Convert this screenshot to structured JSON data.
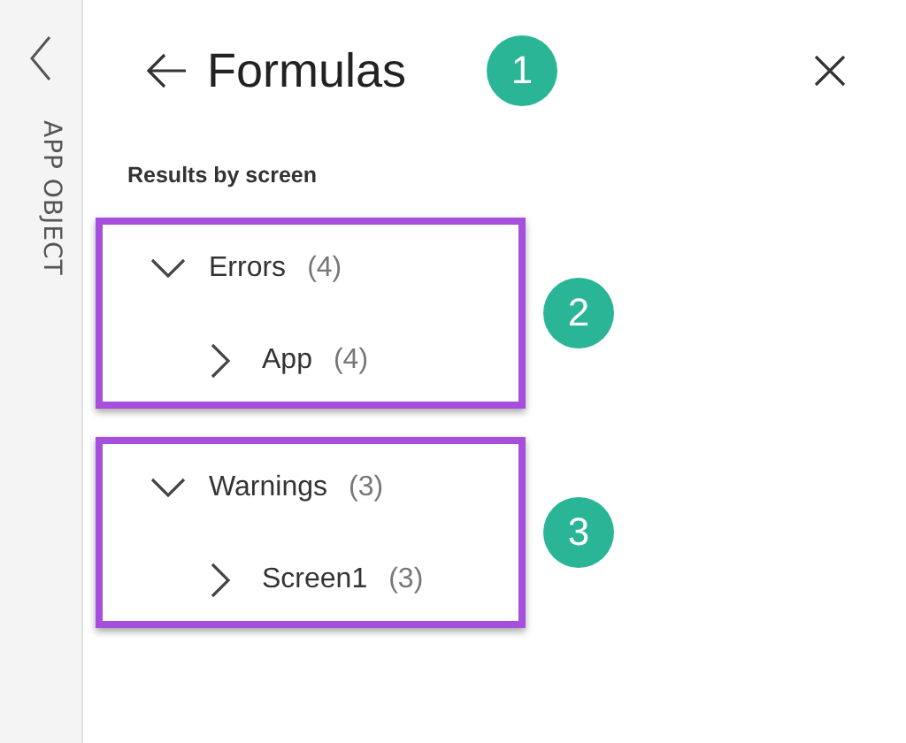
{
  "side_rail": {
    "label": "APP OBJECT"
  },
  "panel": {
    "title": "Formulas",
    "callout": "1"
  },
  "section_title": "Results by screen",
  "groups": [
    {
      "label": "Errors",
      "count": "(4)",
      "expanded": true,
      "callout": "2",
      "children": [
        {
          "label": "App",
          "count": "(4)",
          "expanded": false
        }
      ]
    },
    {
      "label": "Warnings",
      "count": "(3)",
      "expanded": true,
      "callout": "3",
      "children": [
        {
          "label": "Screen1",
          "count": "(3)",
          "expanded": false
        }
      ]
    }
  ]
}
